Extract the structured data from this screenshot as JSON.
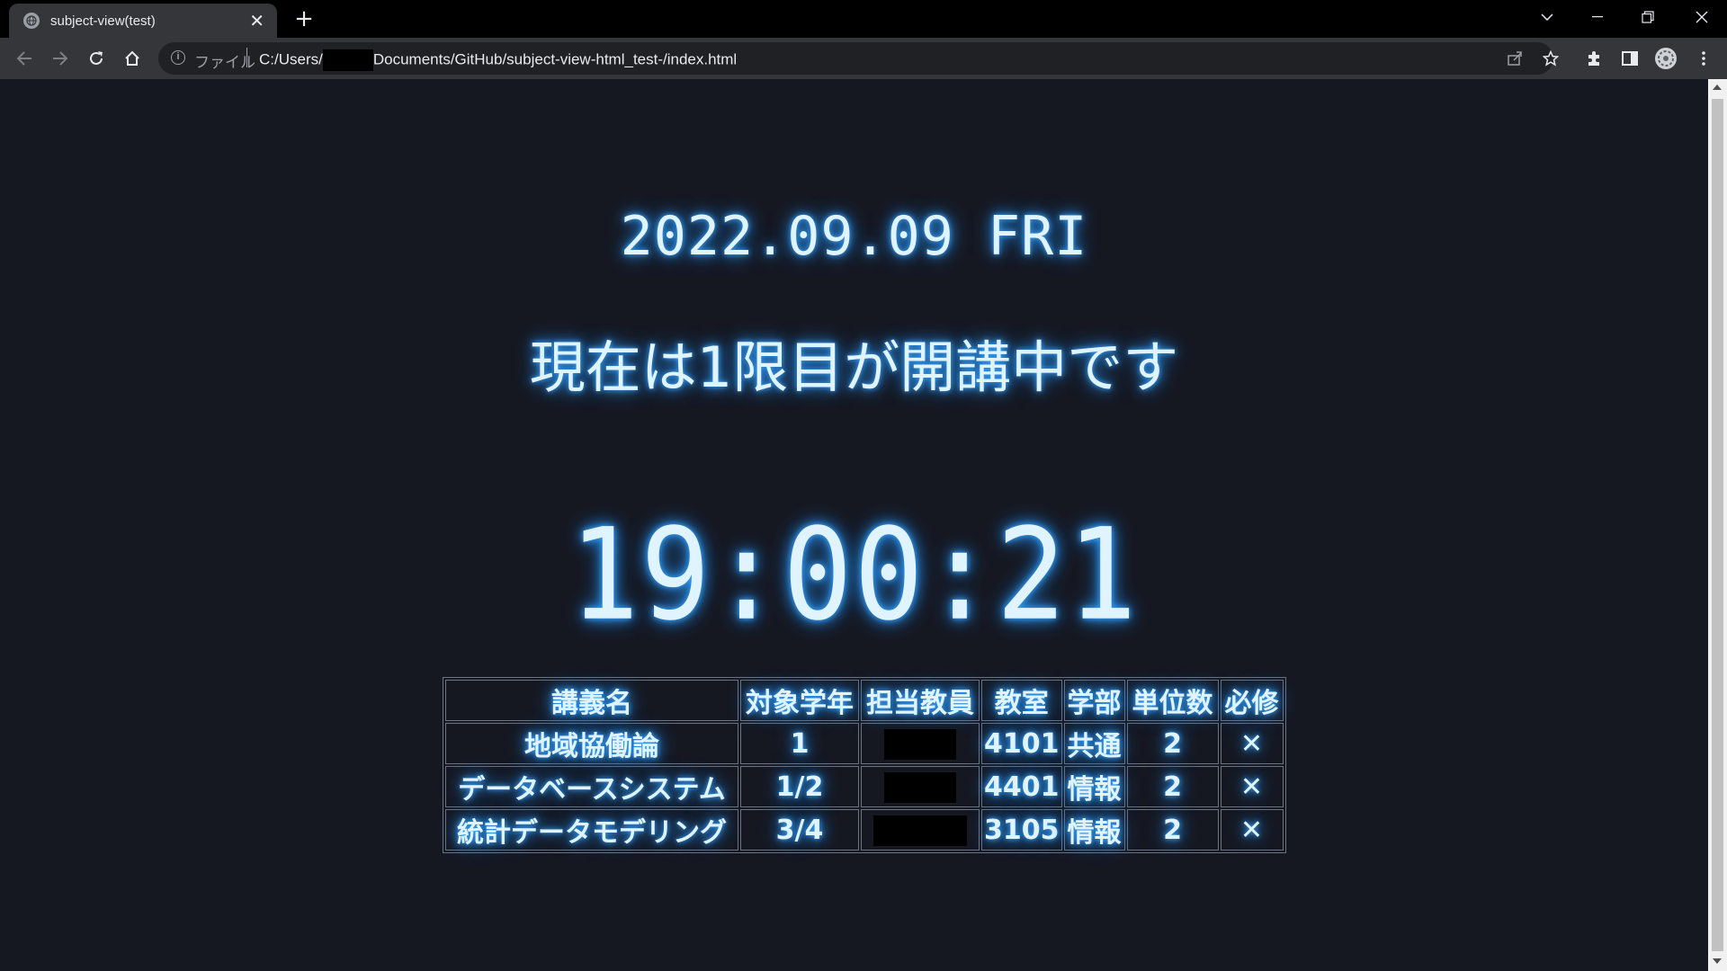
{
  "browser": {
    "tab_title": "subject-view(test)",
    "tab_close": "✕",
    "new_tab": "+",
    "omnibox": {
      "info": "i",
      "scheme_label": "ファイル",
      "url_prefix": "C:/Users/",
      "url_suffix": "Documents/GitHub/subject-view-html_test-/index.html"
    }
  },
  "page": {
    "date": "2022.09.09 FRI",
    "status": "現在は1限目が開講中です",
    "clock": "19:00:21"
  },
  "table": {
    "headers": [
      "講義名",
      "対象学年",
      "担当教員",
      "教室",
      "学部",
      "単位数",
      "必修"
    ],
    "rows": [
      {
        "name": "地域協働論",
        "grade": "1",
        "room": "4101",
        "faculty": "共通",
        "credits": "2",
        "required": "✕"
      },
      {
        "name": "データベースシステム",
        "grade": "1/2",
        "room": "4401",
        "faculty": "情報",
        "credits": "2",
        "required": "✕"
      },
      {
        "name": "統計データモデリング",
        "grade": "3/4",
        "room": "3105",
        "faculty": "情報",
        "credits": "2",
        "required": "✕"
      }
    ]
  },
  "colors": {
    "page_bg": "#161821",
    "glow": "#3aa3ff",
    "text": "#dff4ff"
  }
}
